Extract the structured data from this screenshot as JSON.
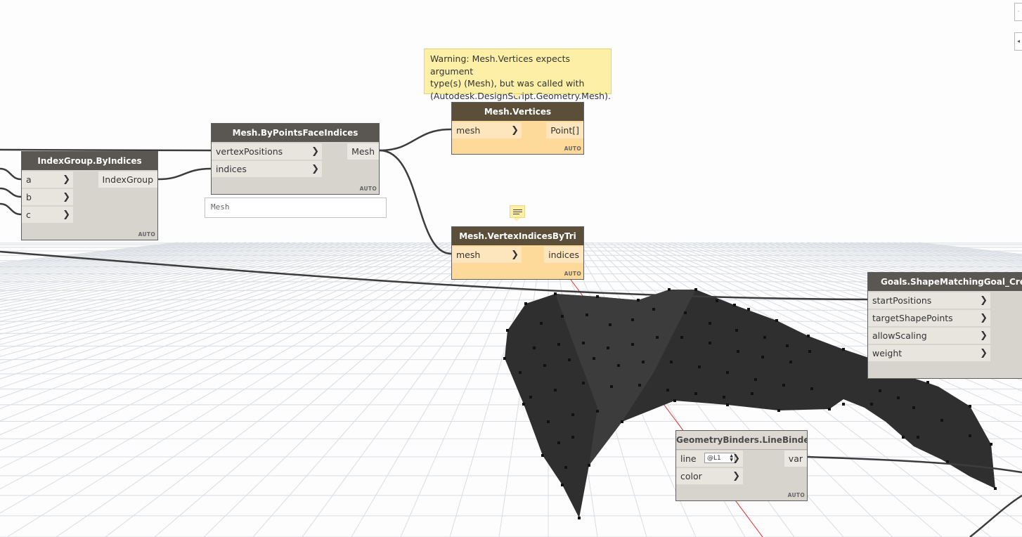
{
  "warning_tooltip": {
    "lines": [
      "Warning: Mesh.Vertices expects argument",
      "type(s) (Mesh), but was called with",
      "(Autodesk.DesignScript.Geometry.Mesh)."
    ]
  },
  "nodes": {
    "index_group": {
      "title": "IndexGroup.ByIndices",
      "inputs": [
        "a",
        "b",
        "c"
      ],
      "output": "IndexGroup",
      "lacing": "AUTO"
    },
    "mesh_by_points": {
      "title": "Mesh.ByPointsFaceIndices",
      "inputs": [
        "vertexPositions",
        "indices"
      ],
      "output": "Mesh",
      "lacing": "AUTO",
      "preview": "Mesh"
    },
    "mesh_vertices": {
      "title": "Mesh.Vertices",
      "inputs": [
        "mesh"
      ],
      "output": "Point[]",
      "lacing": "AUTO"
    },
    "mesh_vertex_indices": {
      "title": "Mesh.VertexIndicesByTri",
      "inputs": [
        "mesh"
      ],
      "output": "indices",
      "lacing": "AUTO"
    },
    "shape_matching": {
      "title": "Goals.ShapeMatchingGoal_Create",
      "inputs": [
        "startPositions",
        "targetShapePoints",
        "allowScaling",
        "weight"
      ]
    },
    "line_binder": {
      "title": "GeometryBinders.LineBinder",
      "inputs": [
        "line",
        "color"
      ],
      "line_value": "@L1",
      "output": "var",
      "lacing": "AUTO"
    }
  },
  "colors": {
    "node_header": "#5a5651",
    "warning_header": "#5c4f39",
    "warning_body": "#fdd99a",
    "wire": "#3c3c3c",
    "mesh": "#2e2e2e"
  }
}
